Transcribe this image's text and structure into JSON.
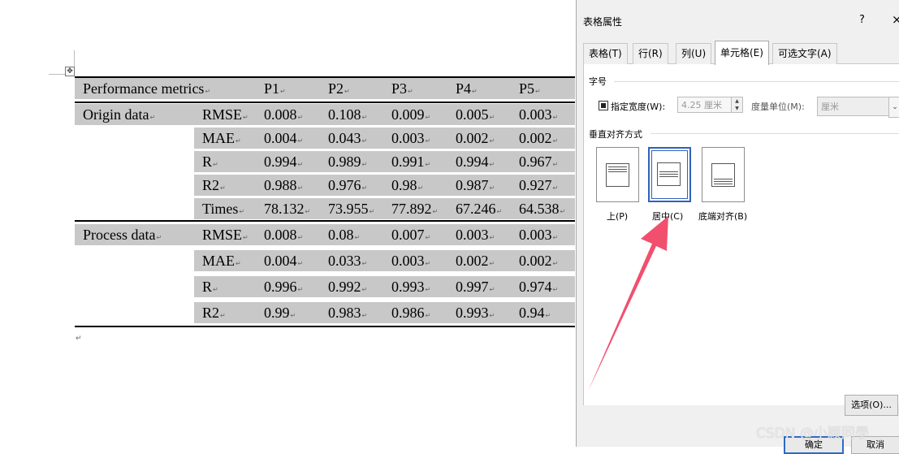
{
  "document": {
    "move_handle": "✥",
    "mark_symbol": "↵",
    "table": {
      "headers": [
        "Performance metrics",
        "P1",
        "P2",
        "P3",
        "P4",
        "P5"
      ],
      "groups": [
        {
          "name": "Origin data",
          "rows": [
            {
              "metric": "RMSE",
              "values": [
                "0.008",
                "0.108",
                "0.009",
                "0.005",
                "0.003"
              ]
            },
            {
              "metric": "MAE",
              "values": [
                "0.004",
                "0.043",
                "0.003",
                "0.002",
                "0.002"
              ]
            },
            {
              "metric": "R",
              "values": [
                "0.994",
                "0.989",
                "0.991",
                "0.994",
                "0.967"
              ]
            },
            {
              "metric": "R2",
              "values": [
                "0.988",
                "0.976",
                "0.98",
                "0.987",
                "0.927"
              ]
            },
            {
              "metric": "Times",
              "values": [
                "78.132",
                "73.955",
                "77.892",
                "67.246",
                "64.538"
              ]
            }
          ]
        },
        {
          "name": "Process data",
          "rows": [
            {
              "metric": "RMSE",
              "values": [
                "0.008",
                "0.08",
                "0.007",
                "0.003",
                "0.003"
              ]
            },
            {
              "metric": "MAE",
              "values": [
                "0.004",
                "0.033",
                "0.003",
                "0.002",
                "0.002"
              ]
            },
            {
              "metric": "R",
              "values": [
                "0.996",
                "0.992",
                "0.993",
                "0.997",
                "0.974"
              ]
            },
            {
              "metric": "R2",
              "values": [
                "0.99",
                "0.983",
                "0.986",
                "0.993",
                "0.94"
              ]
            }
          ]
        }
      ]
    }
  },
  "dialog": {
    "title": "表格属性",
    "help_label": "?",
    "close_label": "×",
    "tabs": [
      {
        "label": "表格(T)",
        "active": false
      },
      {
        "label": "行(R)",
        "active": false
      },
      {
        "label": "列(U)",
        "active": false
      },
      {
        "label": "单元格(E)",
        "active": true
      },
      {
        "label": "可选文字(A)",
        "active": false
      }
    ],
    "size_section": {
      "label": "字号",
      "preferred_width_label": "指定宽度(W):",
      "preferred_width_checked": true,
      "width_value": "4.25 厘米",
      "unit_label": "度量单位(M):",
      "unit_value": "厘米"
    },
    "valign_section": {
      "label": "垂直对齐方式",
      "options": [
        {
          "label": "上(P)",
          "selected": false
        },
        {
          "label": "居中(C)",
          "selected": true
        },
        {
          "label": "底端对齐(B)",
          "selected": false
        }
      ]
    },
    "options_button": "选项(O)...",
    "ok_button": "确定",
    "cancel_button": "取消"
  },
  "annotation": {
    "color": "#f0506e"
  },
  "watermark": "CSDN @小颖同學"
}
